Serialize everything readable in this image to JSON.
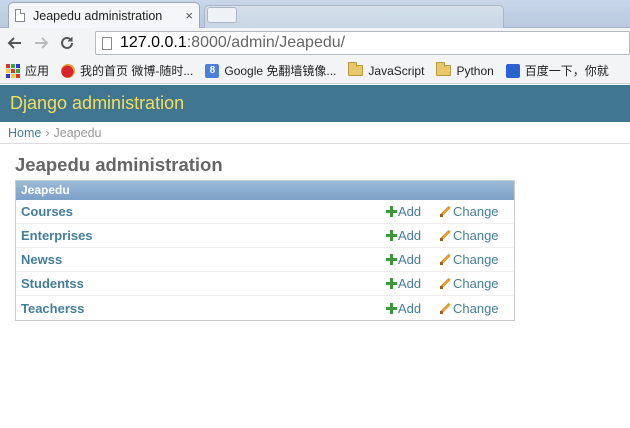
{
  "browser": {
    "tab_title": "Jeapedu administration",
    "tab_close": "×",
    "url_host": "127.0.0.1",
    "url_rest": ":8000/admin/Jeapedu/",
    "bookmarks": [
      {
        "label": "应用",
        "icon": "apps-icon"
      },
      {
        "label": "我的首页 微博-随时...",
        "icon": "weibo-icon"
      },
      {
        "label": "Google 免翻墙镜像...",
        "icon": "google-icon"
      },
      {
        "label": "JavaScript",
        "icon": "folder-icon"
      },
      {
        "label": "Python",
        "icon": "folder-icon"
      },
      {
        "label": "百度一下，你就",
        "icon": "baidu-icon"
      }
    ]
  },
  "header": {
    "brand": "Django administration"
  },
  "breadcrumbs": {
    "home": "Home",
    "separator": "›",
    "current": "Jeapedu"
  },
  "page": {
    "title": "Jeapedu administration"
  },
  "module": {
    "caption": "Jeapedu",
    "add_label": "Add",
    "change_label": "Change",
    "models": [
      "Courses",
      "Enterprises",
      "Newss",
      "Studentss",
      "Teacherss"
    ]
  },
  "colors": {
    "header_bg": "#417690",
    "brand": "#f5dd5d",
    "link": "#447e9b",
    "caption_bg": "#7ca0c7"
  }
}
